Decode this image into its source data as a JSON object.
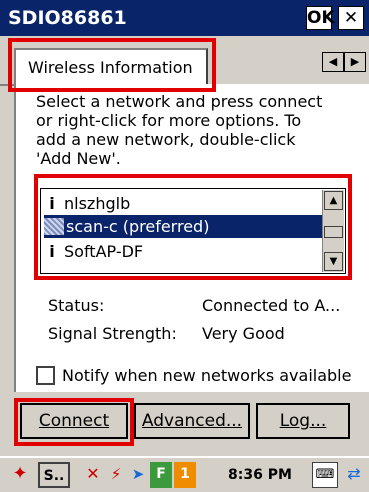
{
  "window": {
    "title": "SDIO86861",
    "ok_label": "OK",
    "close_label": "✕"
  },
  "tabs": {
    "active_label": "Wireless Information",
    "scroll_left": "◀",
    "scroll_right": "▶"
  },
  "instructions": "Select a network and press connect\nor right-click for more options.  To\nadd a new network, double-click\n'Add New'.",
  "networks": [
    {
      "name": "nlszhglb",
      "icon": "signal-icon"
    },
    {
      "name": "scan-c (preferred)",
      "icon": "selected-network-icon",
      "selected": true
    },
    {
      "name": "SoftAP-DF",
      "icon": "signal-icon"
    }
  ],
  "status": {
    "status_label": "Status:",
    "status_value": "Connected to A...",
    "signal_label": "Signal Strength:",
    "signal_value": "Very Good"
  },
  "notify": {
    "label": "Notify when new networks available",
    "checked": false
  },
  "buttons": {
    "connect": "Connect",
    "advanced": "Advanced...",
    "log": "Log..."
  },
  "taskbar": {
    "start_icon": "start-flag-icon",
    "task_label": "S..",
    "clock": "8:36 PM",
    "badge_f": "F",
    "badge_1": "1"
  },
  "colors": {
    "titlebar": "#0a246a",
    "highlight": "#e00000",
    "selection": "#0a246a"
  }
}
